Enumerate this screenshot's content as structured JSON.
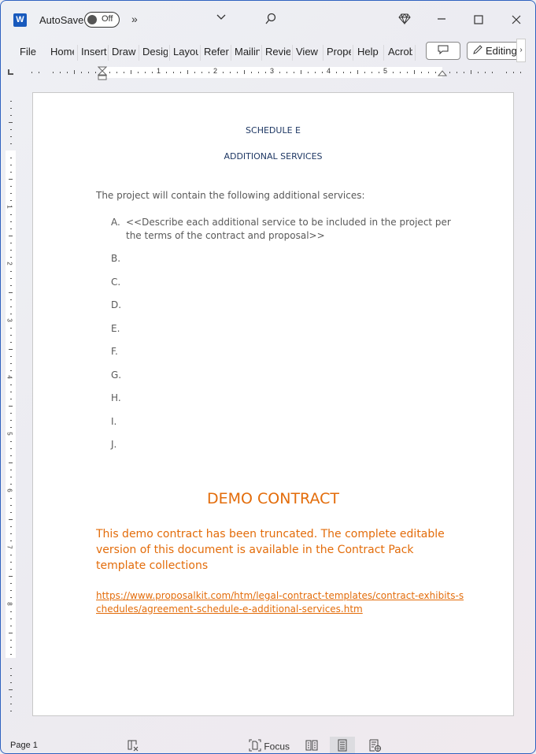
{
  "titlebar": {
    "app_icon": "word-logo-icon",
    "app_icon_letter": "W",
    "autosave_label": "AutoSave",
    "autosave_state": "Off",
    "more_glyph": "»",
    "dropdown_glyph": "⌵",
    "search_glyph": "⚲",
    "premium_glyph": "◇",
    "minimize_glyph": "—",
    "maximize_glyph": "☐",
    "close_glyph": "✕"
  },
  "ribbon": {
    "tabs": [
      {
        "label": "File"
      },
      {
        "label": "Home"
      },
      {
        "label": "Insert"
      },
      {
        "label": "Draw"
      },
      {
        "label": "Design"
      },
      {
        "label": "Layout"
      },
      {
        "label": "References"
      },
      {
        "label": "Mailings"
      },
      {
        "label": "Review"
      },
      {
        "label": "View"
      },
      {
        "label": "Properties"
      },
      {
        "label": "Help"
      },
      {
        "label": "Acrobat"
      }
    ],
    "editing_label": "Editing",
    "more_glyph": "›"
  },
  "ruler": {
    "h_numbers": [
      "1",
      "2",
      "3",
      "4",
      "5"
    ],
    "v_numbers": [
      "1",
      "2",
      "3",
      "4",
      "5",
      "6",
      "7",
      "8"
    ]
  },
  "document": {
    "title1": "SCHEDULE E",
    "title2": "ADDITIONAL SERVICES",
    "intro": "The project will contain the following additional services:",
    "list": [
      {
        "letter": "A.",
        "text": "<<Describe each additional service to be included in the project per the terms of the contract and proposal>>"
      },
      {
        "letter": "B.",
        "text": ""
      },
      {
        "letter": "C.",
        "text": ""
      },
      {
        "letter": "D.",
        "text": ""
      },
      {
        "letter": "E.",
        "text": ""
      },
      {
        "letter": "F.",
        "text": ""
      },
      {
        "letter": "G.",
        "text": ""
      },
      {
        "letter": "H.",
        "text": ""
      },
      {
        "letter": "I.",
        "text": ""
      },
      {
        "letter": "J.",
        "text": ""
      }
    ],
    "demo_title": "DEMO CONTRACT",
    "demo_text": "This demo contract has been truncated. The complete editable version of this document is available in the Contract Pack template collections",
    "demo_link": "https://www.proposalkit.com/htm/legal-contract-templates/contract-exhibits-schedules/agreement-schedule-e-additional-services.htm"
  },
  "statusbar": {
    "page": "Page 1",
    "focus_label": "Focus"
  },
  "colors": {
    "heading": "#1f3864",
    "body": "#595959",
    "demo": "#e36c0a",
    "window_border": "#2f62c0"
  }
}
